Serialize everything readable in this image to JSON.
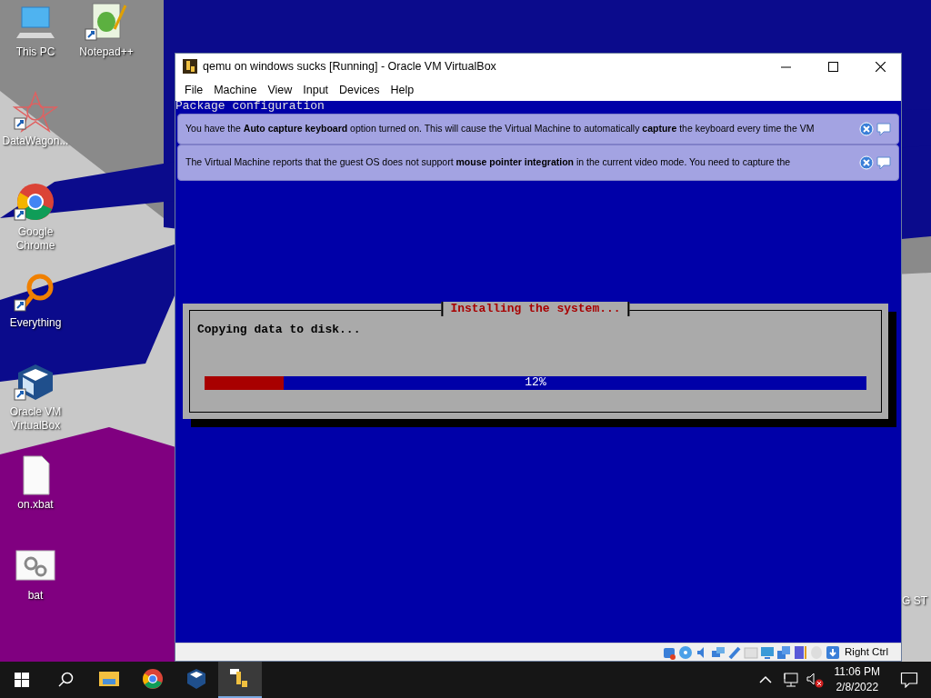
{
  "desktop": {
    "icons": [
      {
        "kind": "computer",
        "label": "This PC"
      },
      {
        "kind": "notepad",
        "label": "Notepad++",
        "shortcut": true
      },
      {
        "kind": "star",
        "label": "DataWagon...",
        "shortcut": true
      },
      {
        "kind": "chrome",
        "label": "Google Chrome",
        "shortcut": true
      },
      {
        "kind": "search",
        "label": "Everything",
        "shortcut": true
      },
      {
        "kind": "cube",
        "label": "Oracle VM VirtualBox",
        "shortcut": true
      },
      {
        "kind": "file",
        "label": "on.xbat"
      },
      {
        "kind": "gears",
        "label": "bat"
      }
    ],
    "partial_text": "G ST"
  },
  "window": {
    "title": "qemu on windows sucks [Running] - Oracle VM VirtualBox",
    "menu": [
      "File",
      "Machine",
      "View",
      "Input",
      "Devices",
      "Help"
    ],
    "notifications": [
      {
        "text": "You have the **Auto capture keyboard** option turned on. This will cause the Virtual Machine to automatically **capture** the keyboard every time the VM"
      },
      {
        "text": "The Virtual Machine reports that the guest OS does not support **mouse pointer integration** in the current video mode. You need to capture the"
      }
    ],
    "guest": {
      "header": "Package configuration",
      "dialog": {
        "title": "Installing the system...",
        "message": "Copying data to disk...",
        "level": 0.12,
        "reading": "12%"
      }
    },
    "status_bar": {
      "host_key": "Right Ctrl"
    }
  },
  "taskbar": {
    "apps": [
      {
        "kind": "explorer",
        "selected": false
      },
      {
        "kind": "chrome",
        "selected": false
      },
      {
        "kind": "cube",
        "selected": false
      },
      {
        "kind": "qemu",
        "selected": true
      }
    ],
    "time": "11:06 PM",
    "date": "2/8/2022"
  }
}
